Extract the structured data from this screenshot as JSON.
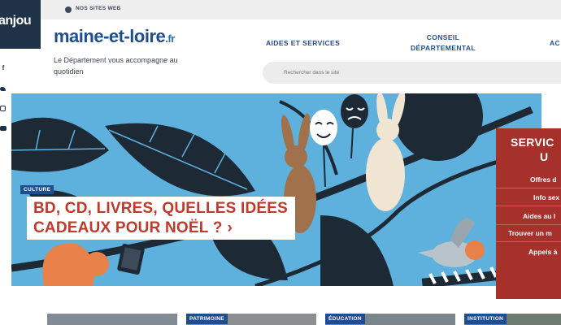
{
  "topbar": {
    "sites_label": "NOS SITES WEB"
  },
  "brand": {
    "anjou": "anjou",
    "logo_main": "maine-et-loire",
    "logo_suffix": ".fr",
    "tagline": "Le Département vous accompagne au quotidien"
  },
  "nav": {
    "aides": "AIDES ET SERVICES",
    "conseil_l1": "CONSEIL",
    "conseil_l2": "DÉPARTEMENTAL",
    "acc": "AC"
  },
  "search": {
    "placeholder": "Rechercher dans le site"
  },
  "hero": {
    "category": "CULTURE",
    "line1": "BD, CD, LIVRES, QUELLES IDÉES",
    "line2": "CADEAUX POUR NOËL ?",
    "chevron": "›"
  },
  "services": {
    "title_l1": "SERVIC",
    "title_l2": "U",
    "items": [
      "Offres d",
      "Info sex",
      "Aides au l",
      "Trouver un m",
      "Appels à"
    ]
  },
  "cards": [
    "PATRIMOINE",
    "ÉDUCATION",
    "INSTITUTION"
  ],
  "colors": {
    "navy": "#1f3248",
    "brand_blue": "#1f4e8c",
    "hero_sky": "#5fb1dd",
    "headline_red": "#c03a2b",
    "panel_red": "#a6302a"
  },
  "icons": [
    "globe-icon",
    "facebook-icon",
    "twitter-icon",
    "instagram-icon",
    "youtube-icon",
    "search-icon",
    "chevron-right-icon"
  ]
}
